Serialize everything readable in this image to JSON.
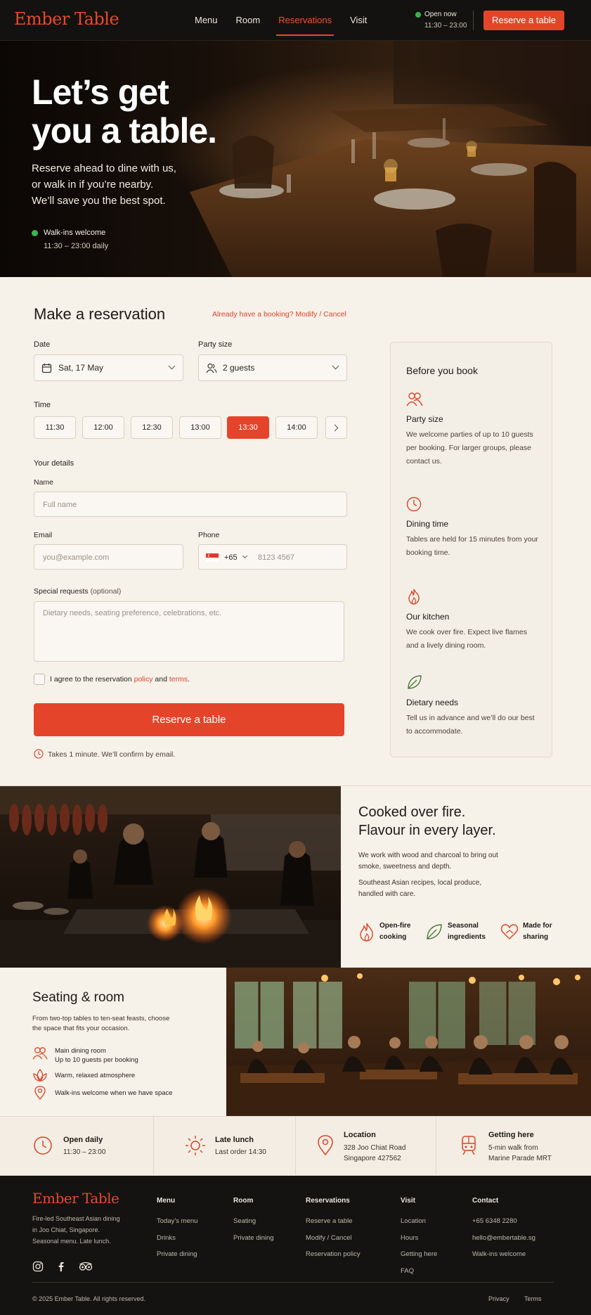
{
  "nav": {
    "brand": "Ember Table",
    "links": [
      "Menu",
      "Room",
      "Reservations",
      "Visit"
    ],
    "active_link": "Reservations",
    "status": "Open now",
    "hours": "11:30 – 23:00",
    "cta": "Reserve a table"
  },
  "hero": {
    "title_line1": "Let’s get",
    "title_line2": "you a table.",
    "sub_line1": "Reserve ahead to dine with us,",
    "sub_line2": "or walk in if you’re nearby.",
    "sub_line3": "We’ll save you the best spot.",
    "walkins": "Walk-ins welcome",
    "walkins_hours": "11:30 – 23:00 daily"
  },
  "reservation": {
    "title": "Make a reservation",
    "already": "Already have a booking?  Modify / Cancel",
    "date_label": "Date",
    "date_value": "Sat, 17 May",
    "party_label": "Party size",
    "party_value": "2 guests",
    "time_label": "Time",
    "times": [
      "11:30",
      "12:00",
      "12:30",
      "13:00",
      "13:30",
      "14:00"
    ],
    "selected_time": "13:30",
    "details_label": "Your details",
    "name_label": "Name",
    "name_placeholder": "Full name",
    "email_label": "Email",
    "email_placeholder": "you@example.com",
    "phone_label": "Phone",
    "phone_code": "+65",
    "phone_placeholder": "8123 4567",
    "requests_label": "Special requests",
    "requests_optional": "(optional)",
    "requests_placeholder": "Dietary needs, seating preference, celebrations, etc.",
    "agree_prefix": "I agree to the reservation ",
    "agree_policy": "policy",
    "agree_and": " and ",
    "agree_terms": "terms",
    "agree_suffix": ".",
    "submit": "Reserve a table",
    "takes": "Takes 1 minute. We’ll confirm by email."
  },
  "before": {
    "title": "Before you book",
    "tips": [
      {
        "icon": "people-icon",
        "title": "Party size",
        "body": "We welcome parties of up to 10 guests per booking. For larger groups, please contact us."
      },
      {
        "icon": "clock-icon",
        "title": "Dining time",
        "body": "Tables are held for 15 minutes from your booking time."
      },
      {
        "icon": "flame-icon",
        "title": "Our kitchen",
        "body": "We cook over fire. Expect live flames and a lively dining room."
      },
      {
        "icon": "leaf-icon",
        "title": "Dietary needs",
        "body": "Tell us in advance and we’ll do our best to accommodate."
      }
    ]
  },
  "cooked": {
    "title_line1": "Cooked over fire.",
    "title_line2": "Flavour in every layer.",
    "p1": "We work with wood and charcoal to bring out smoke, sweetness and depth.",
    "p2": "Southeast Asian recipes, local produce, handled with care.",
    "features": [
      {
        "icon": "flame-icon",
        "line1": "Open-fire",
        "line2": "cooking"
      },
      {
        "icon": "leaf-icon",
        "line1": "Seasonal",
        "line2": "ingredients"
      },
      {
        "icon": "heart-icon",
        "line1": "Made for",
        "line2": "sharing"
      }
    ]
  },
  "seating": {
    "title": "Seating & room",
    "desc": "From two-top tables to ten-seat feasts, choose the space that fits your occasion.",
    "items": [
      {
        "icon": "people-icon",
        "line1": "Main dining room",
        "line2": "Up to 10 guests per booking"
      },
      {
        "icon": "lotus-icon",
        "line1": "Warm, relaxed atmosphere",
        "line2": ""
      },
      {
        "icon": "pin-icon",
        "line1": "Walk-ins welcome when we have space",
        "line2": ""
      }
    ]
  },
  "info": [
    {
      "icon": "clock-icon",
      "title": "Open daily",
      "line1": "11:30 – 23:00",
      "line2": ""
    },
    {
      "icon": "sun-icon",
      "title": "Late lunch",
      "line1": "Last order 14:30",
      "line2": ""
    },
    {
      "icon": "pin-icon",
      "title": "Location",
      "line1": "328 Joo Chiat Road",
      "line2": "Singapore 427562"
    },
    {
      "icon": "train-icon",
      "title": "Getting here",
      "line1": "5-min walk from",
      "line2": "Marine Parade MRT"
    }
  ],
  "footer": {
    "brand": "Ember Table",
    "desc_line1": "Fire-led Southeast Asian dining",
    "desc_line2": "in Joo Chiat, Singapore.",
    "desc_line3": "Seasonal menu. Late lunch.",
    "columns": [
      {
        "title": "Menu",
        "items": [
          "Today’s menu",
          "Drinks",
          "Private dining"
        ]
      },
      {
        "title": "Room",
        "items": [
          "Seating",
          "Private dining"
        ]
      },
      {
        "title": "Reservations",
        "items": [
          "Reserve a table",
          "Modify / Cancel",
          "Reservation policy"
        ]
      },
      {
        "title": "Visit",
        "items": [
          "Location",
          "Hours",
          "Getting here",
          "FAQ"
        ]
      },
      {
        "title": "Contact",
        "items": [
          "+65 6348 2280",
          "hello@embertable.sg",
          "Walk-ins welcome"
        ]
      }
    ],
    "copyright": "© 2025 Ember Table. All rights reserved.",
    "privacy": "Privacy",
    "terms": "Terms"
  },
  "colors": {
    "accent": "#e4452a",
    "dark": "#141210",
    "cream": "#f6f1e9",
    "open": "#3bb54a"
  }
}
